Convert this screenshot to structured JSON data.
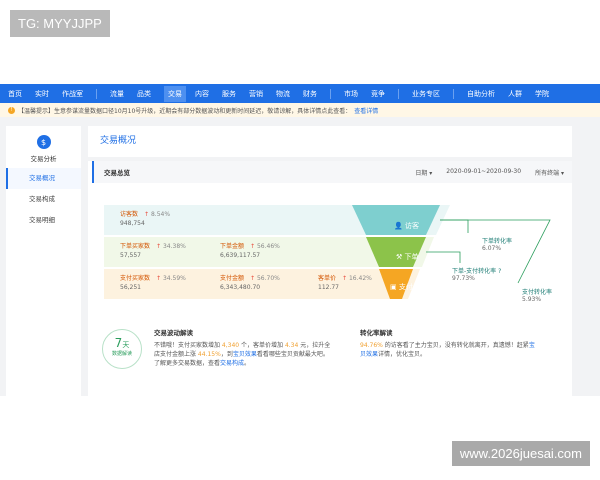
{
  "watermarks": {
    "top_left": "TG: MYYJJPP",
    "bottom_right": "www.2026juesai.com"
  },
  "nav": {
    "items": [
      "首页",
      "实时",
      "作战室",
      "流量",
      "品类",
      "交易",
      "内容",
      "服务",
      "营销",
      "物流",
      "财务",
      "市场",
      "竞争",
      "业务专区",
      "自助分析",
      "人群",
      "学院"
    ],
    "active": "交易"
  },
  "notice": {
    "text": "【温馨提示】生意参谋流量数据口径10月10号升级，近期会有部分数据波动和更新时间延迟，敬请谅解，具体详情点此查看：",
    "link": "查看详情"
  },
  "sidebar": {
    "title": "交易分析",
    "items": [
      "交易概况",
      "交易构成",
      "交易明细"
    ],
    "active_index": 0
  },
  "page_title": "交易概况",
  "section": {
    "title": "交易总览",
    "granularity": "日期",
    "date_range": "2020-09-01~2020-09-30",
    "terminal": "所有终端"
  },
  "metrics": {
    "visitors": {
      "label": "访客数",
      "pct": "8.54%",
      "value": "948,754"
    },
    "order_buyers": {
      "label": "下单买家数",
      "pct": "34.38%",
      "value": "57,557"
    },
    "order_amount": {
      "label": "下单金额",
      "pct": "56.46%",
      "value": "6,639,117.57"
    },
    "pay_buyers": {
      "label": "支付买家数",
      "pct": "34.59%",
      "value": "56,251"
    },
    "pay_amount": {
      "label": "支付金额",
      "pct": "56.70%",
      "value": "6,343,480.70"
    },
    "unit_price": {
      "label": "客单价",
      "pct": "16.42%",
      "value": "112.77"
    }
  },
  "funnel": {
    "stages": [
      {
        "label": "访客",
        "color": "#7ecfcf"
      },
      {
        "label": "下单",
        "color": "#8cc34a"
      },
      {
        "label": "支付",
        "color": "#f5a623"
      }
    ],
    "order_conversion": {
      "label": "下单转化率",
      "value": "6.07%"
    },
    "order_pay_conversion": {
      "label": "下单-支付转化率",
      "value": "97.73%"
    },
    "pay_conversion": {
      "label": "支付转化率",
      "value": "5.93%"
    }
  },
  "badge": {
    "number": "7",
    "unit": "天",
    "caption": "数据解读"
  },
  "interpretation": {
    "fluctuation": {
      "title": "交易波动解读",
      "line1_a": "不错哦！支付买家数增加 ",
      "line1_b": "4,340",
      "line1_c": " 个，客单价增加 ",
      "line1_d": "4.34",
      "line1_e": " 元，拉升全",
      "line2_a": "店支付金额上涨 ",
      "line2_b": "44.15%",
      "line2_c": "，到",
      "line2_d": "宝贝效果",
      "line2_e": "看看哪些宝贝贡献最大吧。",
      "line3_a": "了解更多交易数据，查看",
      "line3_b": "交易构成",
      "line3_c": "。"
    },
    "conversion": {
      "title": "转化率解读",
      "line1_a": "94.76%",
      "line1_b": " 的访客看了主力宝贝，没有转化就离开，真遗憾！赶紧",
      "line1_c": "宝",
      "line2_a": "贝效果",
      "line2_b": "详情，优化宝贝。"
    }
  }
}
